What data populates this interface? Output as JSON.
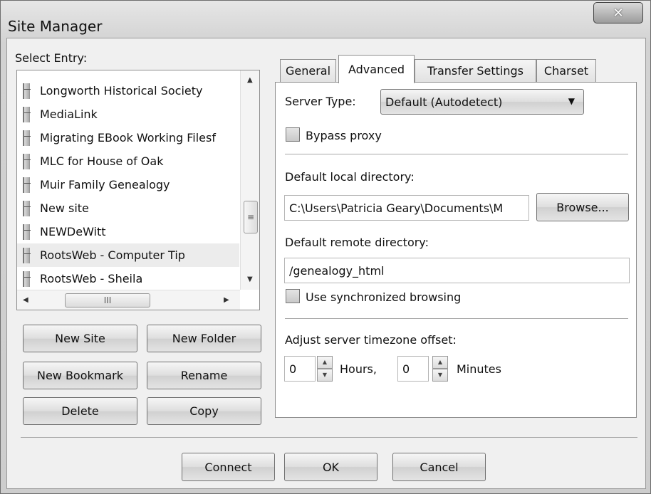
{
  "window": {
    "title": "Site Manager"
  },
  "site_list": {
    "label": "Select Entry:",
    "items": [
      {
        "label": "Longworth Historical Society"
      },
      {
        "label": "MediaLink"
      },
      {
        "label": "Migrating EBook Working Filesf"
      },
      {
        "label": "MLC for House of Oak"
      },
      {
        "label": "Muir Family Genealogy"
      },
      {
        "label": "New site"
      },
      {
        "label": "NEWDeWitt"
      },
      {
        "label": "RootsWeb - Computer Tip",
        "selected": true
      },
      {
        "label": "RootsWeb - Sheila"
      }
    ]
  },
  "buttons": {
    "new_site": "New Site",
    "new_folder": "New Folder",
    "new_bookmark": "New Bookmark",
    "rename": "Rename",
    "delete": "Delete",
    "copy": "Copy",
    "connect": "Connect",
    "ok": "OK",
    "cancel": "Cancel"
  },
  "tabs": [
    {
      "label": "General",
      "active": false
    },
    {
      "label": "Advanced",
      "active": true
    },
    {
      "label": "Transfer Settings",
      "active": false
    },
    {
      "label": "Charset",
      "active": false
    }
  ],
  "advanced": {
    "server_type_label": "Server Type:",
    "server_type_value": "Default (Autodetect)",
    "bypass_proxy_label": "Bypass proxy",
    "bypass_proxy_checked": false,
    "local_dir_label": "Default local directory:",
    "local_dir_value": "C:\\Users\\Patricia Geary\\Documents\\M",
    "browse_label": "Browse...",
    "remote_dir_label": "Default remote directory:",
    "remote_dir_value": "/genealogy_html",
    "sync_browsing_label": "Use synchronized browsing",
    "sync_browsing_checked": false,
    "timezone_label": "Adjust server timezone offset:",
    "hours_value": "0",
    "hours_label": "Hours,",
    "minutes_value": "0",
    "minutes_label": "Minutes"
  },
  "scrollbars": {
    "thumb_grip": "III"
  }
}
